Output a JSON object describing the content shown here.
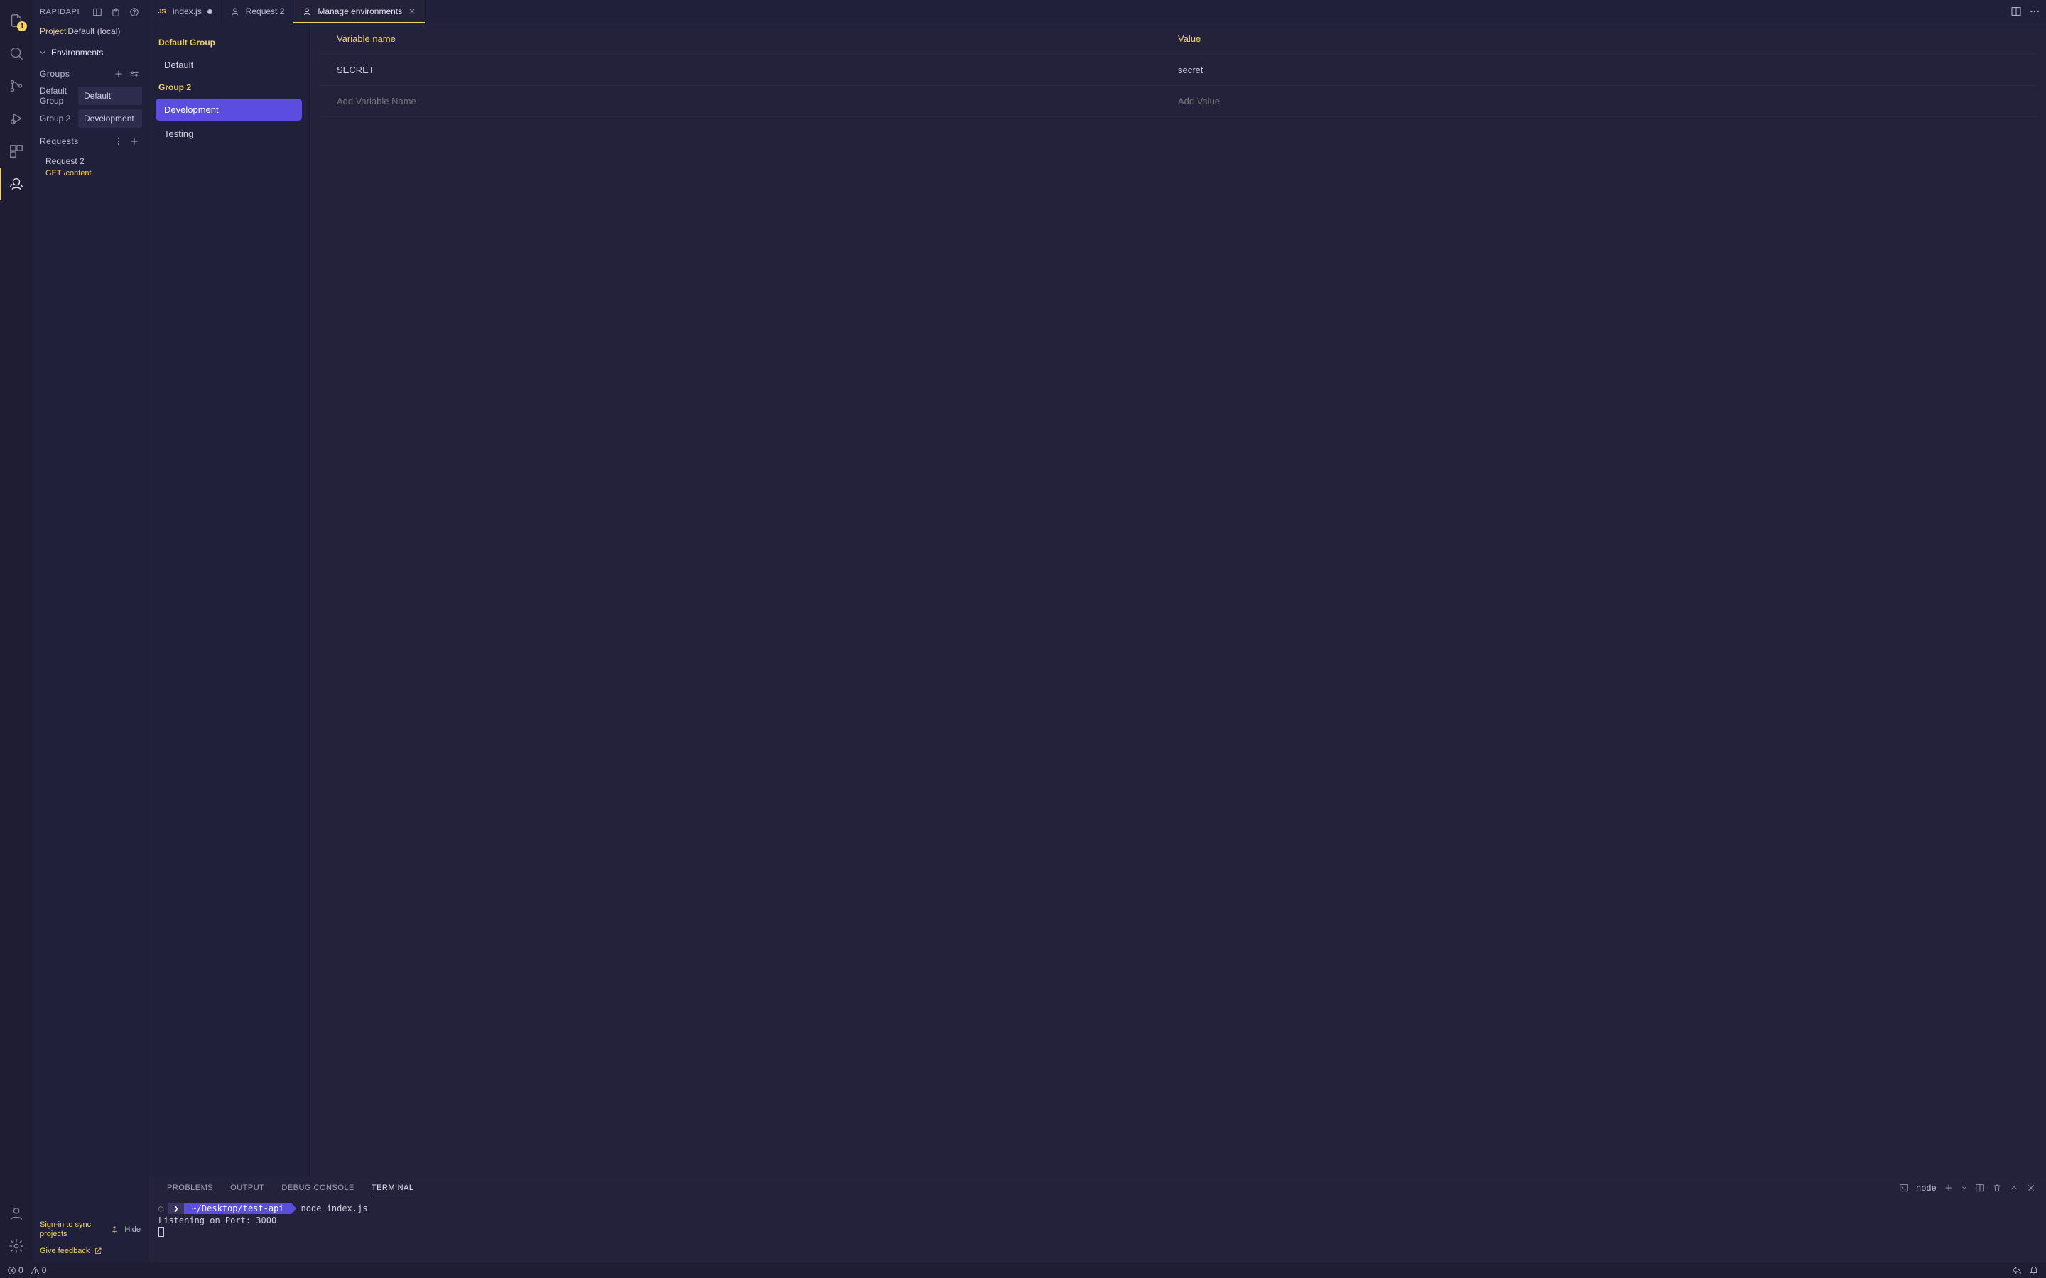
{
  "sidebar_title": "RAPIDAPI",
  "project": {
    "label": "Project",
    "value": "Default (local)"
  },
  "environments": {
    "header": "Environments",
    "groups_label": "Groups",
    "groups": [
      {
        "name": "Default Group",
        "env": "Default"
      },
      {
        "name": "Group 2",
        "env": "Development"
      }
    ]
  },
  "requests": {
    "header": "Requests",
    "items": [
      {
        "title": "Request 2",
        "subtitle": "GET /content"
      }
    ]
  },
  "footer": {
    "sync_msg": "Sign-in to sync projects",
    "hide": "Hide",
    "feedback": "Give feedback"
  },
  "env_panel": {
    "groups": [
      {
        "name": "Default Group",
        "items": [
          "Default"
        ]
      },
      {
        "name": "Group 2",
        "items": [
          "Development",
          "Testing"
        ]
      }
    ],
    "selected": "Development"
  },
  "tabs": [
    {
      "kind": "js",
      "label": "index.js",
      "dirty": true
    },
    {
      "kind": "req",
      "label": "Request 2"
    },
    {
      "kind": "env",
      "label": "Manage environments",
      "active": true,
      "closable": true
    }
  ],
  "var_table": {
    "head_name": "Variable name",
    "head_value": "Value",
    "rows": [
      {
        "name": "SECRET",
        "value": "secret"
      }
    ],
    "add_name_ph": "Add Variable Name",
    "add_value_ph": "Add Value"
  },
  "panel": {
    "tabs": [
      "PROBLEMS",
      "OUTPUT",
      "DEBUG CONSOLE",
      "TERMINAL"
    ],
    "active": "TERMINAL",
    "term_label": "node",
    "prompt_arrow": "❯",
    "cwd": "~/Desktop/test-api",
    "command": "node index.js",
    "output": "Listening on Port: 3000"
  },
  "status": {
    "errors": "0",
    "warnings": "0"
  },
  "activity_badge": "1"
}
